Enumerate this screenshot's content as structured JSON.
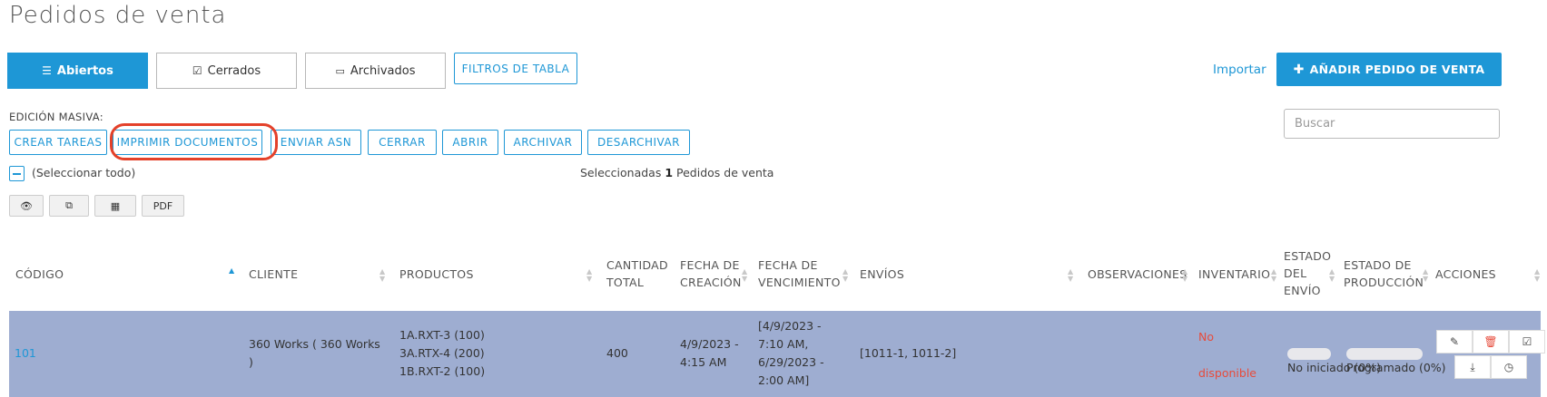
{
  "page": {
    "title": "Pedidos de venta"
  },
  "tabs": [
    {
      "label": "Abiertos",
      "icon": "list-icon",
      "active": true
    },
    {
      "label": "Cerrados",
      "icon": "check-square-icon",
      "active": false
    },
    {
      "label": "Archivados",
      "icon": "inbox-icon",
      "active": false
    }
  ],
  "filters_label": "FILTROS DE TABLA",
  "import_label": "Importar",
  "add_button_label": "AÑADIR PEDIDO DE VENTA",
  "search": {
    "placeholder": "Buscar",
    "value": ""
  },
  "bulk": {
    "label": "EDICIÓN MASIVA:",
    "actions": [
      "CREAR TAREAS",
      "IMPRIMIR DOCUMENTOS",
      "ENVIAR ASN",
      "CERRAR",
      "ABRIR",
      "ARCHIVAR",
      "DESARCHIVAR"
    ]
  },
  "select_all_label": "(Seleccionar todo)",
  "selection": {
    "prefix": "Seleccionadas",
    "count": "1",
    "suffix": "Pedidos de venta"
  },
  "toolbar": {
    "view_icon": "eye-icon",
    "copy_icon": "copy-icon",
    "table_icon": "table-icon",
    "pdf_label": "PDF"
  },
  "columns": {
    "code": "CÓDIGO",
    "client": "CLIENTE",
    "products": "PRODUCTOS",
    "qty": [
      "CANTIDAD",
      "TOTAL"
    ],
    "created": [
      "FECHA DE",
      "CREACIÓN"
    ],
    "due": [
      "FECHA DE",
      "VENCIMIENTO"
    ],
    "shipments": "ENVÍOS",
    "notes": "OBSERVACIONES",
    "inventory": "INVENTARIO",
    "ship_status": [
      "ESTADO",
      "DEL",
      "ENVÍO"
    ],
    "prod_status": [
      "ESTADO DE",
      "PRODUCCIÓN"
    ],
    "actions": "ACCIONES"
  },
  "row": {
    "code": "101",
    "client": [
      "360 Works ( 360 Works",
      ")"
    ],
    "products": [
      "1A.RXT-3 (100)",
      "3A.RTX-4 (200)",
      "1B.RXT-2 (100)"
    ],
    "qty": "400",
    "created": [
      "4/9/2023 -",
      "4:15 AM"
    ],
    "due": [
      "[4/9/2023 -",
      "7:10 AM,",
      "6/29/2023 -",
      "2:00 AM]"
    ],
    "shipments": "[1011-1, 1011-2]",
    "inventory": [
      "No",
      "disponible"
    ],
    "ship_status": {
      "label": "No iniciado (0%)",
      "progress": 0
    },
    "prod_status": {
      "label": "Programado (0%)",
      "progress": 0
    },
    "action_icons": [
      "edit-icon",
      "trash-icon",
      "check-square-icon",
      "download-icon",
      "clock-icon"
    ]
  },
  "colors": {
    "accent": "#1e97d6",
    "selected_row": "#9eadd1",
    "danger": "#e74c3c",
    "highlight": "#e4412a"
  }
}
